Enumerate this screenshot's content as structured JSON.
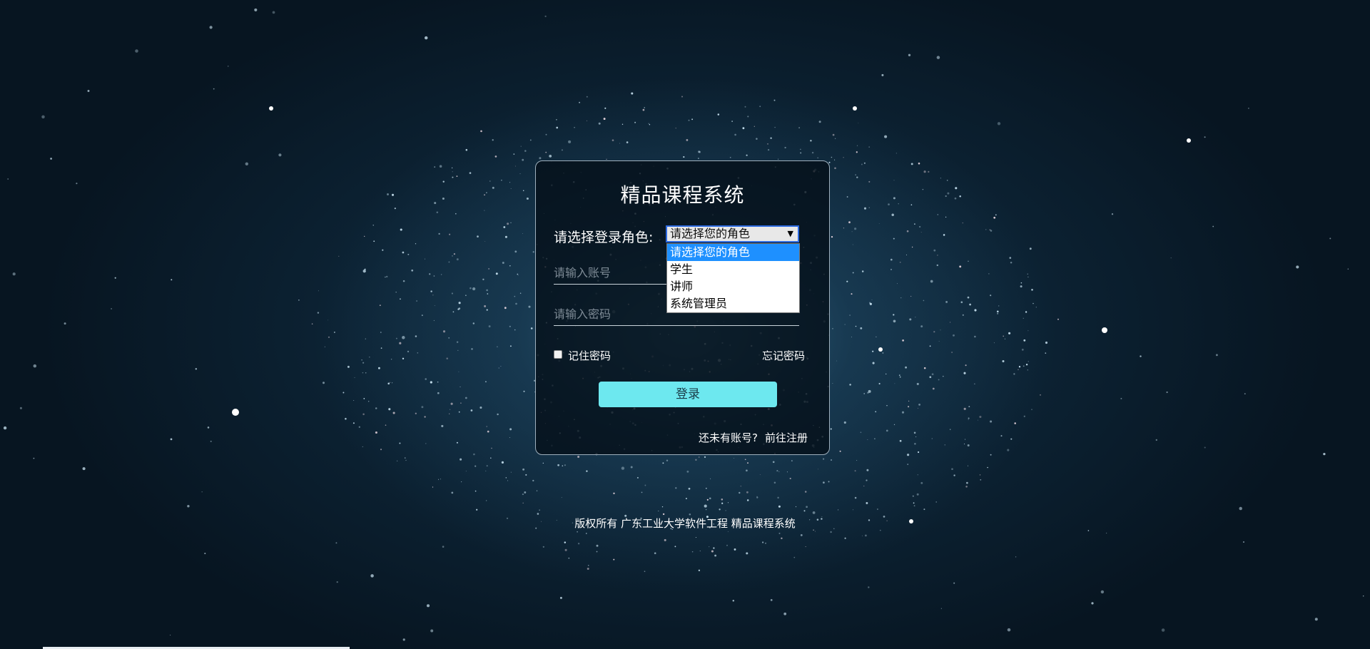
{
  "app": {
    "title": "精品课程系统"
  },
  "login": {
    "role_label": "请选择登录角色:",
    "role_selected": "请选择您的角色",
    "role_options": [
      "请选择您的角色",
      "学生",
      "讲师",
      "系统管理员"
    ],
    "account_placeholder": "请输入账号",
    "password_placeholder": "请输入密码",
    "remember_label": "记住密码",
    "forgot_label": "忘记密码",
    "submit_label": "登录",
    "no_account_text": "还未有账号?",
    "register_link": "前往注册"
  },
  "footer": {
    "copyright": "版权所有 广东工业大学软件工程 精品课程系统"
  },
  "colors": {
    "button_bg": "#6de8ef",
    "dropdown_highlight": "#1e90ff",
    "page_bg": "#0c2233"
  },
  "icons": {
    "caret": "chevron-down-icon"
  }
}
